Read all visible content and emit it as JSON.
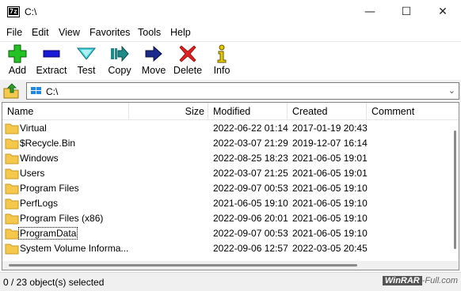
{
  "window": {
    "title": "C:\\",
    "icon_text": "7z",
    "minimize_glyph": "—",
    "maximize_glyph": "☐",
    "close_glyph": "✕"
  },
  "menu": [
    "File",
    "Edit",
    "View",
    "Favorites",
    "Tools",
    "Help"
  ],
  "toolbar": [
    {
      "label": "Add",
      "icon": "add-icon"
    },
    {
      "label": "Extract",
      "icon": "extract-icon"
    },
    {
      "label": "Test",
      "icon": "test-icon"
    },
    {
      "label": "Copy",
      "icon": "copy-icon"
    },
    {
      "label": "Move",
      "icon": "move-icon"
    },
    {
      "label": "Delete",
      "icon": "delete-icon"
    },
    {
      "label": "Info",
      "icon": "info-icon"
    }
  ],
  "address": {
    "value": "C:\\",
    "chevron": "⌄"
  },
  "columns": [
    "Name",
    "Size",
    "Modified",
    "Created",
    "Comment"
  ],
  "rows": [
    {
      "name": "Virtual",
      "size": "",
      "modified": "2022-06-22 01:14",
      "created": "2017-01-19 20:43",
      "comment": ""
    },
    {
      "name": "$Recycle.Bin",
      "size": "",
      "modified": "2022-03-07 21:29",
      "created": "2019-12-07 16:14",
      "comment": ""
    },
    {
      "name": "Windows",
      "size": "",
      "modified": "2022-08-25 18:23",
      "created": "2021-06-05 19:01",
      "comment": ""
    },
    {
      "name": "Users",
      "size": "",
      "modified": "2022-03-07 21:25",
      "created": "2021-06-05 19:01",
      "comment": ""
    },
    {
      "name": "Program Files",
      "size": "",
      "modified": "2022-09-07 00:53",
      "created": "2021-06-05 19:10",
      "comment": ""
    },
    {
      "name": "PerfLogs",
      "size": "",
      "modified": "2021-06-05 19:10",
      "created": "2021-06-05 19:10",
      "comment": ""
    },
    {
      "name": "Program Files (x86)",
      "size": "",
      "modified": "2022-09-06 20:01",
      "created": "2021-06-05 19:10",
      "comment": ""
    },
    {
      "name": "ProgramData",
      "size": "",
      "modified": "2022-09-07 00:53",
      "created": "2021-06-05 19:10",
      "comment": ""
    },
    {
      "name": "System Volume Informa...",
      "size": "",
      "modified": "2022-09-06 12:57",
      "created": "2022-03-05 20:45",
      "comment": ""
    }
  ],
  "status": {
    "text": "0 / 23 object(s) selected",
    "watermark_brand": "WinRAR",
    "watermark_rest": "-Full.com"
  }
}
